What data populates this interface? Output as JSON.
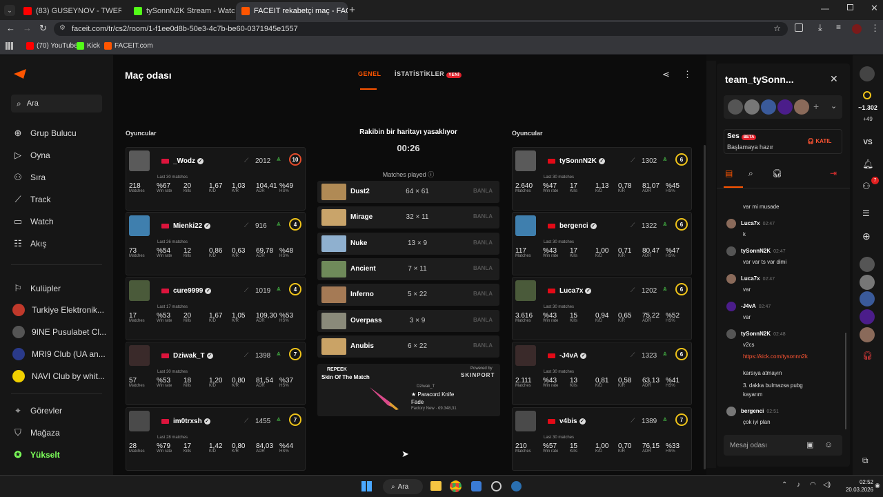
{
  "browser": {
    "tabs": [
      {
        "title": "(83) GUSEYNOV - TWERK (",
        "active": false
      },
      {
        "title": "tySonnN2K Stream - Watch Live",
        "active": false
      },
      {
        "title": "FACEIT rekabetçi maç - FACEIT",
        "active": true
      }
    ],
    "url": "faceit.com/tr/cs2/room/1-f1ee0d8b-50e3-4c7b-be60-0371945e1557",
    "bookmarks": [
      "(70) YouTube",
      "Kick",
      "FACEIT.com"
    ]
  },
  "sidebar": {
    "search_label": "Ara",
    "items": [
      "Grup Bulucu",
      "Oyna",
      "Sıra",
      "Track",
      "Watch",
      "Akış"
    ],
    "clubs_label": "Kulüpler",
    "clubs": [
      "Turkiye Elektronik...",
      "9INE Pusulabet Cl...",
      "MRI9 Club (UA an...",
      "NAVI Club by whit..."
    ],
    "bottom_items": [
      "Görevler",
      "Mağaza",
      "Yükselt"
    ]
  },
  "room": {
    "title": "Maç odası",
    "tabs": [
      "GENEL",
      "İSTATİSTİKLER"
    ],
    "new_badge": "YENİ",
    "players_label": "Oyuncular",
    "veto_title": "Rakibin bir haritayı yasaklıyor",
    "timer": "00:26",
    "matches_played": "Matches played",
    "ban_label": "BANLA",
    "stat_labels": [
      "Matches",
      "Win rate",
      "Kills",
      "K/D",
      "K/R",
      "ADR",
      "HS%"
    ]
  },
  "team_left": [
    {
      "name": "_Wodz",
      "elo": "2012",
      "level": "10",
      "last": "Last 30 matches",
      "matches": "218",
      "winrate": "%67",
      "kills": "20",
      "kd": "1,67",
      "kr": "1,03",
      "adr": "104,41",
      "hs": "%49",
      "level_color": "#e54c2b"
    },
    {
      "name": "Mienki22",
      "elo": "916",
      "level": "4",
      "last": "Last 26 matches",
      "matches": "73",
      "winrate": "%54",
      "kills": "12",
      "kd": "0,86",
      "kr": "0,63",
      "adr": "69,78",
      "hs": "%48",
      "level_color": "#f0c419"
    },
    {
      "name": "cure9999",
      "elo": "1019",
      "level": "4",
      "last": "Last 17 matches",
      "matches": "17",
      "winrate": "%53",
      "kills": "20",
      "kd": "1,67",
      "kr": "1,05",
      "adr": "109,30",
      "hs": "%53",
      "level_color": "#f0c419"
    },
    {
      "name": "Dziwak_T",
      "elo": "1398",
      "level": "7",
      "last": "Last 30 matches",
      "matches": "57",
      "winrate": "%53",
      "kills": "18",
      "kd": "1,20",
      "kr": "0,80",
      "adr": "81,54",
      "hs": "%37",
      "level_color": "#f0c419"
    },
    {
      "name": "im0trxsh",
      "elo": "1455",
      "level": "7",
      "last": "Last 28 matches",
      "matches": "28",
      "winrate": "%79",
      "kills": "17",
      "kd": "1,42",
      "kr": "0,80",
      "adr": "84,03",
      "hs": "%44",
      "level_color": "#f0c419"
    }
  ],
  "team_right": [
    {
      "name": "tySonnN2K",
      "elo": "1302",
      "level": "6",
      "last": "Last 30 matches",
      "matches": "2.640",
      "winrate": "%47",
      "kills": "17",
      "kd": "1,13",
      "kr": "0,78",
      "adr": "81,07",
      "hs": "%45",
      "level_color": "#f0c419"
    },
    {
      "name": "bergenci",
      "elo": "1322",
      "level": "6",
      "last": "Last 30 matches",
      "matches": "117",
      "winrate": "%43",
      "kills": "17",
      "kd": "1,00",
      "kr": "0,71",
      "adr": "80,47",
      "hs": "%47",
      "level_color": "#f0c419"
    },
    {
      "name": "Luca7x",
      "elo": "1202",
      "level": "6",
      "last": "Last 30 matches",
      "matches": "3.616",
      "winrate": "%43",
      "kills": "15",
      "kd": "0,94",
      "kr": "0,65",
      "adr": "75,22",
      "hs": "%52",
      "level_color": "#f0c419"
    },
    {
      "name": "-J4vA",
      "elo": "1323",
      "level": "6",
      "last": "Last 30 matches",
      "matches": "2.111",
      "winrate": "%43",
      "kills": "13",
      "kd": "0,81",
      "kr": "0,58",
      "adr": "63,13",
      "hs": "%41",
      "level_color": "#f0c419"
    },
    {
      "name": "v4bis",
      "elo": "1389",
      "level": "7",
      "last": "Last 30 matches",
      "matches": "210",
      "winrate": "%57",
      "kills": "15",
      "kd": "1,00",
      "kr": "0,70",
      "adr": "76,15",
      "hs": "%33",
      "level_color": "#f0c419"
    }
  ],
  "maps": [
    {
      "name": "Dust2",
      "score": "64 × 61",
      "color": "#b08a55"
    },
    {
      "name": "Mirage",
      "score": "32 × 11",
      "color": "#c9a46a"
    },
    {
      "name": "Nuke",
      "score": "13 × 9",
      "color": "#8fb0cf"
    },
    {
      "name": "Ancient",
      "score": "7 × 11",
      "color": "#6f8a5a"
    },
    {
      "name": "Inferno",
      "score": "5 × 22",
      "color": "#a57a55"
    },
    {
      "name": "Overpass",
      "score": "3 × 9",
      "color": "#8a8a7a"
    },
    {
      "name": "Anubis",
      "score": "6 × 22",
      "color": "#caa366"
    }
  ],
  "skin": {
    "brand": "REPEEK",
    "title": "Skin Of The Match",
    "powered": "Powered by",
    "sponsor": "SKINPORT",
    "owner": "Dziwak_T",
    "item": "★ Paracord Knife",
    "item2": "Fade",
    "condition": "Factory New · €9.348,31"
  },
  "chat": {
    "title": "team_tySonn...",
    "voice_label": "Ses",
    "beta": "BETA",
    "voice_status": "Başlamaya hazır",
    "join": "KATIL",
    "messages": [
      {
        "user": "",
        "time": "",
        "text": "var mi musade"
      },
      {
        "user": "Luca7x",
        "time": "02:47",
        "text": "k"
      },
      {
        "user": "tySonnN2K",
        "time": "02:47",
        "text": "var var ts var dimi"
      },
      {
        "user": "Luca7x",
        "time": "02:47",
        "text": "var"
      },
      {
        "user": "-J4vA",
        "time": "02:47",
        "text": "var"
      },
      {
        "user": "tySonnN2K",
        "time": "02:48",
        "text": "v2cs"
      },
      {
        "user": "",
        "time": "",
        "text": "https://kick.com/tysonnn2k"
      },
      {
        "user": "",
        "time": "",
        "text": "karsıya atmayın"
      },
      {
        "user": "",
        "time": "",
        "text": "3. dakka bulmazsa pubg"
      },
      {
        "user": "",
        "time": "",
        "text": "kayarım"
      },
      {
        "user": "bergenci",
        "time": "02:51",
        "text": "çok iyi plan"
      }
    ],
    "input_placeholder": "Mesaj odası"
  },
  "rail": {
    "points": "~1.302",
    "plus": "+49",
    "vs": "VS",
    "notif_count": "7"
  },
  "taskbar": {
    "search": "Ara",
    "time": "02:52",
    "date": "20.03.2026"
  }
}
